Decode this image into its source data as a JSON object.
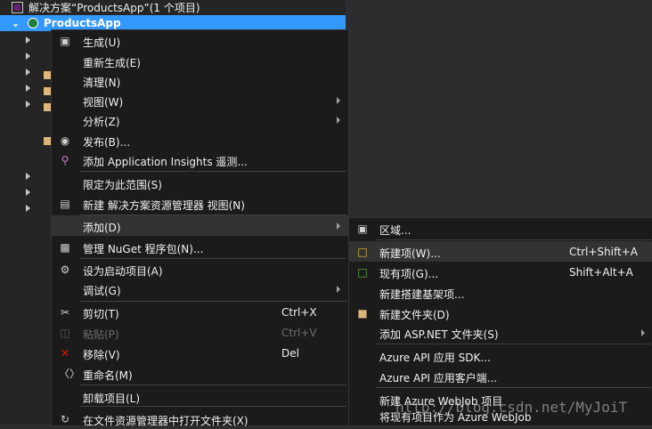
{
  "explorer": {
    "solution_label": "解决方案“ProductsApp”(1 个项目)",
    "project_label": "ProductsApp"
  },
  "context_menu": {
    "items": [
      {
        "icon": "build-icon",
        "label": "生成(U)"
      },
      {
        "label": "重新生成(E)"
      },
      {
        "label": "清理(N)"
      },
      {
        "label": "视图(W)",
        "submenu": true
      },
      {
        "label": "分析(Z)",
        "submenu": true
      },
      {
        "icon": "publish-globe-icon",
        "label": "发布(B)..."
      },
      {
        "icon": "application-insights-icon",
        "label": "添加 Application Insights 遥测..."
      },
      {
        "label": "限定为此范围(S)"
      },
      {
        "icon": "new-view-icon",
        "label": "新建 解决方案资源管理器 视图(N)"
      },
      {
        "label": "添加(D)",
        "submenu": true,
        "highlighted": true
      },
      {
        "icon": "nuget-icon",
        "label": "管理 NuGet 程序包(N)..."
      },
      {
        "icon": "gear-icon",
        "label": "设为启动项目(A)"
      },
      {
        "label": "调试(G)",
        "submenu": true
      },
      {
        "icon": "scissors-icon",
        "label": "剪切(T)",
        "shortcut": "Ctrl+X"
      },
      {
        "icon": "paste-icon",
        "label": "粘贴(P)",
        "shortcut": "Ctrl+V",
        "disabled": true
      },
      {
        "icon": "delete-x-icon",
        "label": "移除(V)",
        "shortcut": "Del"
      },
      {
        "icon": "rename-icon",
        "label": "重命名(M)"
      },
      {
        "label": "卸载项目(L)"
      },
      {
        "icon": "open-folder-refresh-icon",
        "label": "在文件资源管理器中打开文件夹(X)"
      }
    ]
  },
  "add_submenu": {
    "items": [
      {
        "icon": "area-icon",
        "label": "区域..."
      },
      {
        "icon": "new-item-icon",
        "label": "新建项(W)...",
        "shortcut": "Ctrl+Shift+A",
        "highlighted": true
      },
      {
        "icon": "existing-item-icon",
        "label": "现有项(G)...",
        "shortcut": "Shift+Alt+A"
      },
      {
        "label": "新建搭建基架项..."
      },
      {
        "icon": "new-folder-icon",
        "label": "新建文件夹(D)"
      },
      {
        "label": "添加 ASP.NET 文件夹(S)",
        "submenu": true
      },
      {
        "label": "Azure API 应用 SDK..."
      },
      {
        "label": "Azure API 应用客户端..."
      },
      {
        "label": "新建 Azure WebJob 项目"
      },
      {
        "label": "将现有项目作为 Azure WebJob"
      }
    ]
  },
  "watermark": "http://blog.csdn.net/MyJoiT",
  "colors": {
    "selection": "#3399ff",
    "menu_bg": "#1b1b1c",
    "hover": "#333334",
    "delete_icon": "#e51400"
  }
}
